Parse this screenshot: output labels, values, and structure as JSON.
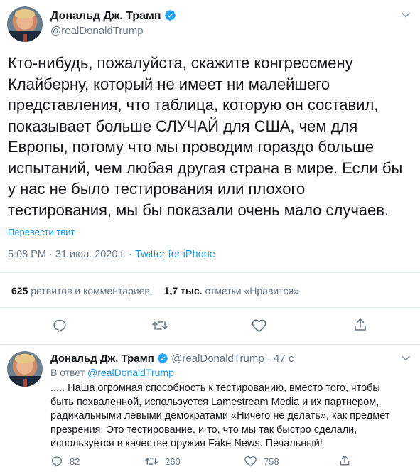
{
  "main_tweet": {
    "author_name": "Дональд Дж. Трамп",
    "handle": "@realDonaldTrump",
    "text_lines": [
      "Кто-нибудь, пожалуйста, скажите конгрессмену",
      "Клайберну, который не имеет ни малейшего",
      "представления, что таблица, которую он составил,",
      "показывает больше СЛУЧАЙ для США, чем для",
      "Европы, потому что мы проводим гораздо больше",
      "испытаний, чем любая другая страна в мире. Если бы",
      "у нас не было тестирования или плохого",
      "тестирования, мы бы показали очень мало случаев."
    ],
    "translate_label": "Перевести твит",
    "time": "5:08 PM · 31 июл. 2020 г. · ",
    "source": "Twitter for iPhone",
    "retweets_count": "625",
    "retweets_label": "ретвитов и комментариев",
    "likes_count": "1,7 тыс.",
    "likes_label": "отметки «Нравится»"
  },
  "reply_tweet": {
    "author_name": "Дональд Дж. Трамп",
    "handle": "@realDonaldTrump",
    "age": "· 47 с",
    "in_reply_prefix": "В ответ ",
    "in_reply_handle": "@realDonaldTrump",
    "text_lines": [
      "..... Наша огромная способность к тестированию, вместо того, чтобы",
      "быть похваленной, используется Lamestream Media и их партнером,",
      "радикальными левыми демократами «Ничего не делать», как предмет",
      "презрения. Это тестирование, и то, что мы так быстро сделали,",
      "используется в качестве оружия Fake News. Печальный!"
    ],
    "reply_count": "82",
    "retweet_count": "260",
    "like_count": "758"
  },
  "colors": {
    "accent": "#1da1f2",
    "link": "#1b95e0",
    "muted": "#657786",
    "divider": "#e6ecf0"
  },
  "icons": [
    "verified-badge-icon",
    "chevron-down-icon",
    "reply-icon",
    "retweet-icon",
    "like-icon",
    "share-icon"
  ]
}
